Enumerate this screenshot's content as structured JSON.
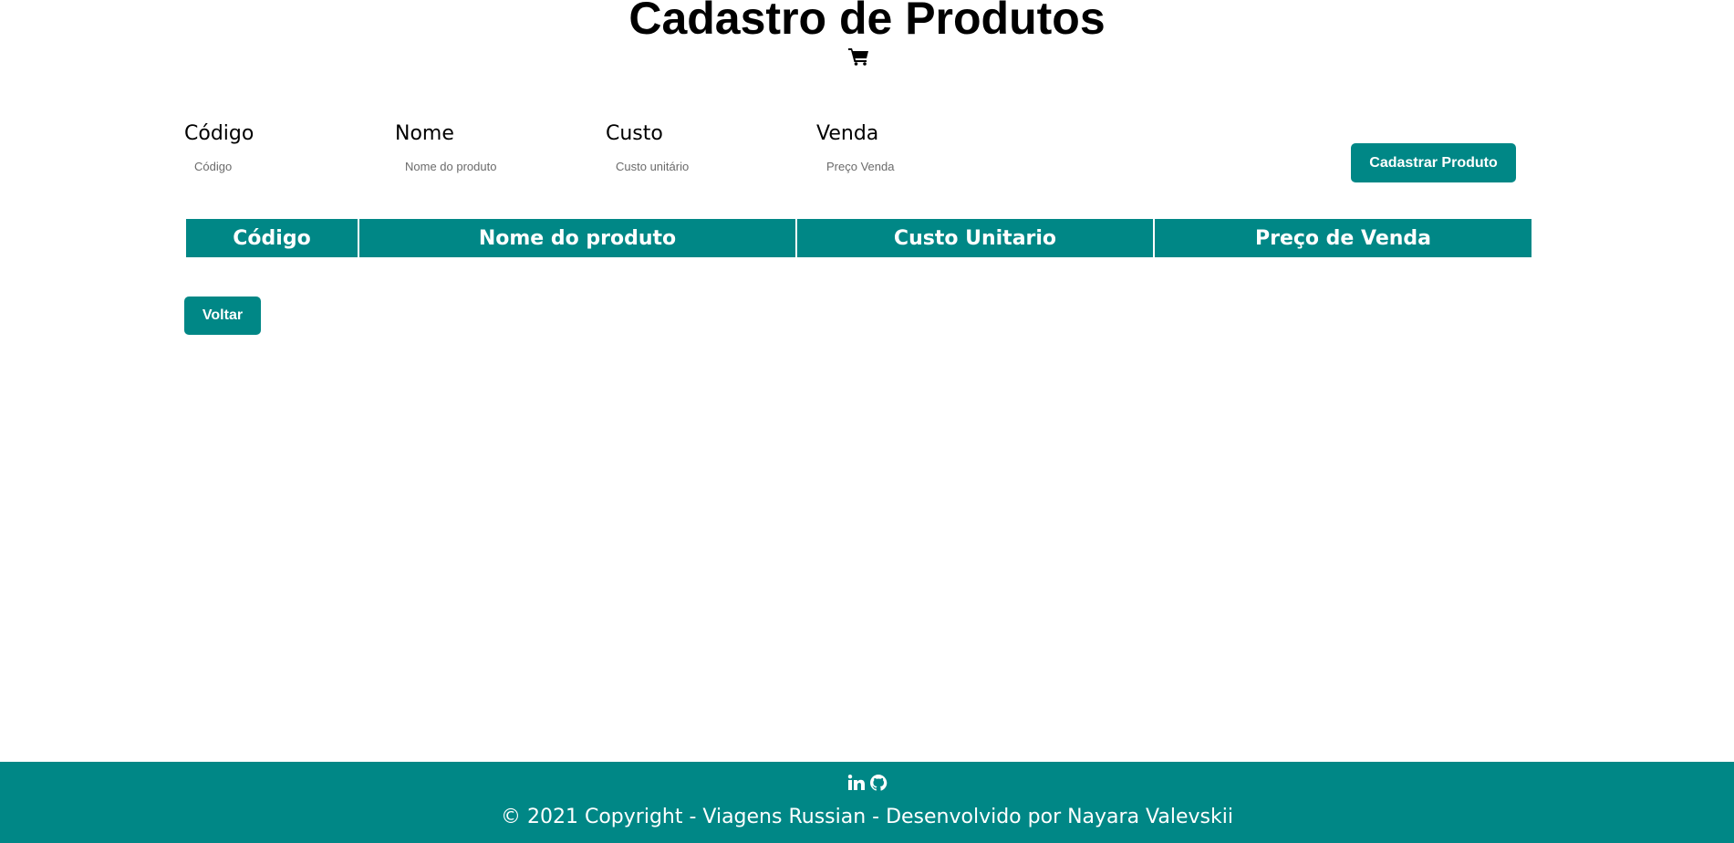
{
  "header": {
    "title": "Cadastro de Produtos",
    "icon": "shopping-cart-icon"
  },
  "form": {
    "fields": [
      {
        "label": "Código",
        "placeholder": "Código",
        "value": ""
      },
      {
        "label": "Nome",
        "placeholder": "Nome do produto",
        "value": ""
      },
      {
        "label": "Custo",
        "placeholder": "Custo unitário",
        "value": ""
      },
      {
        "label": "Venda",
        "placeholder": "Preço Venda",
        "value": ""
      }
    ],
    "submit_label": "Cadastrar Produto"
  },
  "table": {
    "columns": [
      "Código",
      "Nome do produto",
      "Custo Unitario",
      "Preço de Venda"
    ],
    "rows": []
  },
  "back_label": "Voltar",
  "footer": {
    "icons": [
      "linkedin-icon",
      "github-icon"
    ],
    "copyright": "© 2021 Copyright - Viagens Russian - Desenvolvido por Nayara Valevskii"
  },
  "colors": {
    "accent": "#008786",
    "text": "#000000",
    "background": "#ffffff"
  }
}
